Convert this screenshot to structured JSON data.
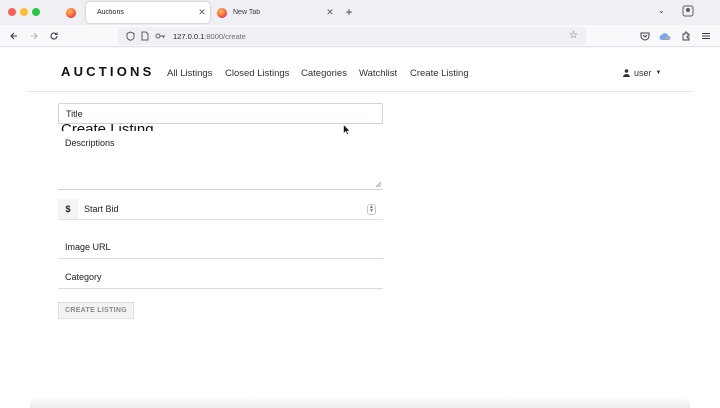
{
  "browser": {
    "tabs": [
      {
        "label": "Auctions",
        "active": true
      },
      {
        "label": "New Tab",
        "active": false
      }
    ],
    "new_tab_symbol": "+",
    "url": {
      "host": "127.0.0.1",
      "path": ":8000/create"
    },
    "icons": [
      "back-icon",
      "forward-icon",
      "reload-icon",
      "shield-icon",
      "page-icon",
      "key-icon",
      "star-icon",
      "pocket-icon",
      "extension-icon",
      "menu-icon"
    ]
  },
  "nav": {
    "brand": "AUCTIONS",
    "links": [
      "All Listings",
      "Closed Listings",
      "Categories",
      "Watchlist",
      "Create Listing"
    ],
    "user": "user"
  },
  "form": {
    "heading": "Create Listing",
    "title_placeholder": "Title",
    "description_placeholder": "Descriptions",
    "currency_symbol": "$",
    "start_bid_placeholder": "Start Bid",
    "image_url_placeholder": "Image URL",
    "category_placeholder": "Category",
    "submit_label": "CREATE LISTING"
  },
  "colors": {
    "chrome_bg": "#f0f0f4",
    "page_bg": "#ffffff",
    "text": "#111111",
    "border": "#ced4da"
  }
}
